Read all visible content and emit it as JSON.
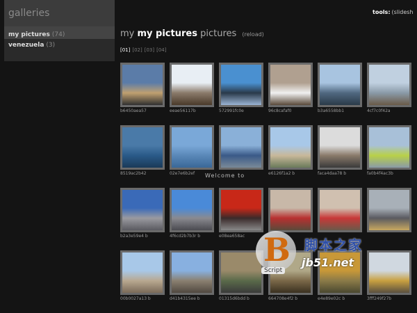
{
  "sidebar": {
    "header": "galleries",
    "items": [
      {
        "label": "my pictures",
        "count": "(74)"
      },
      {
        "label": "venezuela",
        "count": "(3)"
      }
    ]
  },
  "tools": {
    "label": "tools:",
    "value": "(slidesh"
  },
  "page": {
    "title_prefix": "my",
    "title_bold": "my pictures",
    "title_suffix": "pictures",
    "reload": "(reload)"
  },
  "pagination": [
    "[01]",
    "[02]",
    "[03]",
    "[04]"
  ],
  "thumbs": [
    {
      "caption": "b6450aea57",
      "colors": [
        "#5b7ca8",
        "#c0a070",
        "#303030"
      ]
    },
    {
      "caption": "eeae56117b",
      "colors": [
        "#e8eef4",
        "#8a7a6a",
        "#4a3a2a"
      ]
    },
    {
      "caption": "572991fc0e",
      "colors": [
        "#4a90d0",
        "#2a3a4a",
        "#9ab4d4"
      ]
    },
    {
      "caption": "96c8cafaf0",
      "colors": [
        "#b0a090",
        "#f0f0f0",
        "#5a4a3a"
      ]
    },
    {
      "caption": "b3a6558bb1",
      "colors": [
        "#a8c4e0",
        "#506880",
        "#2a3a48"
      ]
    },
    {
      "caption": "4cf7c0f42a",
      "colors": [
        "#c0d0e0",
        "#8a9aa8",
        "#6a5a48"
      ]
    },
    {
      "caption": "8519ac2b42",
      "colors": [
        "#4a7aa8",
        "#2a5a88",
        "#1a3a58"
      ]
    },
    {
      "caption": "02e7e6b2ef",
      "colors": [
        "#7aa8d8",
        "#5a88b8",
        "#3a6898"
      ]
    },
    {
      "caption": "",
      "colors": [
        "#8ab0d8",
        "#3a5a88",
        "#7a8a98"
      ]
    },
    {
      "caption": "e6126f1a2 b",
      "colors": [
        "#a8c8e8",
        "#c8b89a",
        "#6a7a5a"
      ]
    },
    {
      "caption": "faca4daa78 b",
      "colors": [
        "#dcdcdc",
        "#8a7a6a",
        "#3a3a3a"
      ]
    },
    {
      "caption": "fa0b4f4ac3b",
      "colors": [
        "#a8c0d8",
        "#b8d048",
        "#8a9aa8"
      ]
    },
    {
      "caption": "b2a3e59e4 b",
      "colors": [
        "#3a6ab8",
        "#9a9aa0",
        "#5a5a60"
      ]
    },
    {
      "caption": "4f6cd2b7b3r b",
      "colors": [
        "#4a8ad8",
        "#8a8a90",
        "#4a4a50"
      ]
    },
    {
      "caption": "e08ea658ac",
      "colors": [
        "#c82818",
        "#3a2a2a",
        "#888888"
      ]
    },
    {
      "caption": "",
      "colors": [
        "#c8b8a8",
        "#b83030",
        "#5a4a3a"
      ]
    },
    {
      "caption": "",
      "colors": [
        "#d0c0b0",
        "#c83838",
        "#6a5a4a"
      ]
    },
    {
      "caption": "",
      "colors": [
        "#a8b0b8",
        "#5a5a60",
        "#c8a860"
      ]
    },
    {
      "caption": "00b0027a13 b",
      "colors": [
        "#a8c8e8",
        "#b8a890",
        "#7a6a58"
      ]
    },
    {
      "caption": "d41b4315ee b",
      "colors": [
        "#88b0e0",
        "#8a8070",
        "#504840"
      ]
    },
    {
      "caption": "01315d6bdd b",
      "colors": [
        "#9a8a6a",
        "#5a6a4a",
        "#3a3a3a"
      ]
    },
    {
      "caption": "664708e4f2 b",
      "colors": [
        "#b0a888",
        "#7a6848",
        "#3a3020"
      ]
    },
    {
      "caption": "e4e89e02c b",
      "colors": [
        "#c89838",
        "#8a7a48",
        "#4a4830"
      ]
    },
    {
      "caption": "3fff249f27b",
      "colors": [
        "#d0d8e0",
        "#c8a040",
        "#5a5040"
      ]
    }
  ],
  "overlay_text": "Welcome to",
  "watermark": {
    "logo_letter": "B",
    "script": "Script",
    "cn": "脚本之家",
    "url": "jb51.net"
  }
}
